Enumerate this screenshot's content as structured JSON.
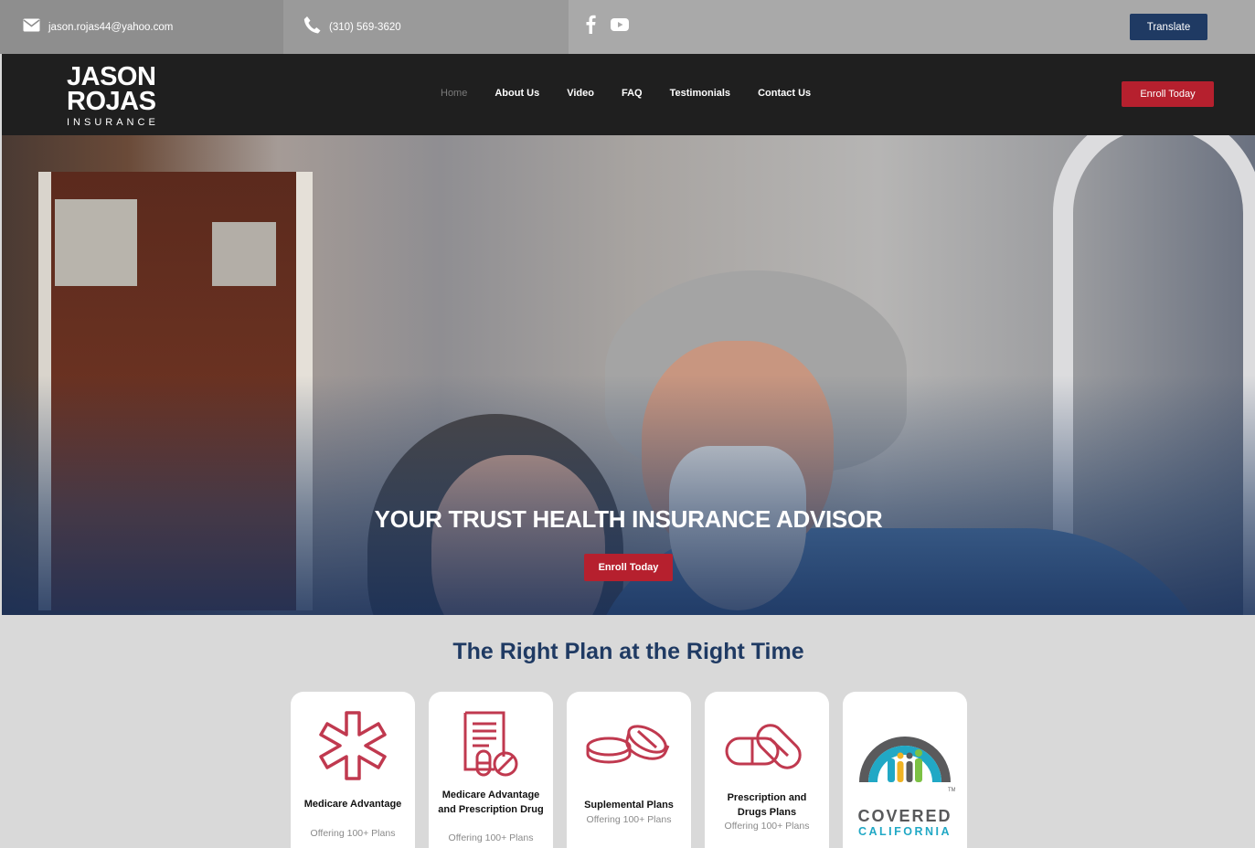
{
  "topbar": {
    "email": "jason.rojas44@yahoo.com",
    "phone": "(310) 569-3620",
    "social": [
      "facebook-icon",
      "youtube-icon"
    ],
    "translate_label": "Translate"
  },
  "header": {
    "logo": {
      "line1": "JASON",
      "line2": "ROJAS",
      "line3": "INSURANCE"
    },
    "nav": [
      "Home",
      "About Us",
      "Video",
      "FAQ",
      "Testimonials",
      "Contact Us"
    ],
    "active_nav": "Home",
    "enroll_label": "Enroll Today"
  },
  "hero": {
    "title": "YOUR TRUST HEALTH INSURANCE ADVISOR",
    "button_label": "Enroll Today"
  },
  "plans": {
    "title": "The Right Plan at the Right Time",
    "cards": [
      {
        "title": "Medicare Advantage",
        "subtitle": "Offering 100+ Plans",
        "icon": "medical-star-icon"
      },
      {
        "title": "Medicare Advantage and Prescription Drug",
        "subtitle": "Offering 100+ Plans",
        "icon": "prescription-icon"
      },
      {
        "title": "Suplemental Plans",
        "subtitle": "Offering 100+ Plans",
        "icon": "pills-icon"
      },
      {
        "title": "Prescription and Drugs Plans",
        "subtitle": "Offering 100+ Plans",
        "icon": "capsule-icon"
      },
      {
        "logo_line1": "COVERED",
        "logo_line2": "CALIFORNIA",
        "logo_mark": "TM",
        "icon": "covered-california-logo"
      }
    ]
  },
  "colors": {
    "brand_navy": "#1f3a63",
    "accent_red": "#b6202e",
    "icon_red": "#c0394f",
    "header_bg": "#1f1f1f"
  }
}
